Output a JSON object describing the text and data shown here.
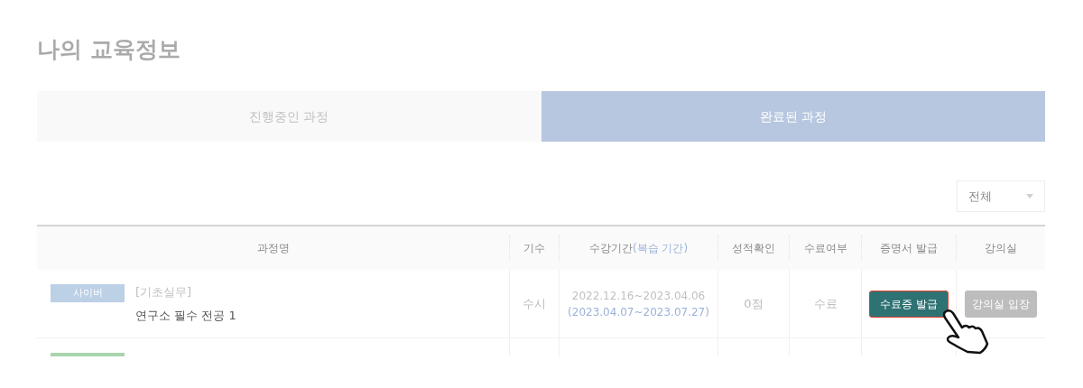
{
  "page_title": "나의 교육정보",
  "tabs": [
    {
      "label": "진행중인 과정",
      "selected": false
    },
    {
      "label": "완료된 과정",
      "selected": true
    }
  ],
  "filter": {
    "value": "전체"
  },
  "table": {
    "columns": [
      {
        "label": "과정명"
      },
      {
        "label": "기수"
      },
      {
        "label": "수강기간",
        "note": "(복습 기간)"
      },
      {
        "label": "성적확인"
      },
      {
        "label": "수료여부"
      },
      {
        "label": "증명서 발급"
      },
      {
        "label": "강의실"
      }
    ],
    "rows": [
      {
        "badge": "사이버",
        "color": "#bcd0e6",
        "category": "[기초실무]",
        "course": "연구소 필수 전공 1",
        "term": "수시",
        "period": "2022.12.16~2023.04.06",
        "review_period": "(2023.04.07~2023.07.27)",
        "score": "0점",
        "completion": "수료",
        "certificate": {
          "label": "수료증 발급",
          "highlighted": true
        },
        "classroom": {
          "label": "강의실 입장",
          "disabled": true
        }
      },
      {
        "color": "#a9d5ae"
      }
    ]
  }
}
